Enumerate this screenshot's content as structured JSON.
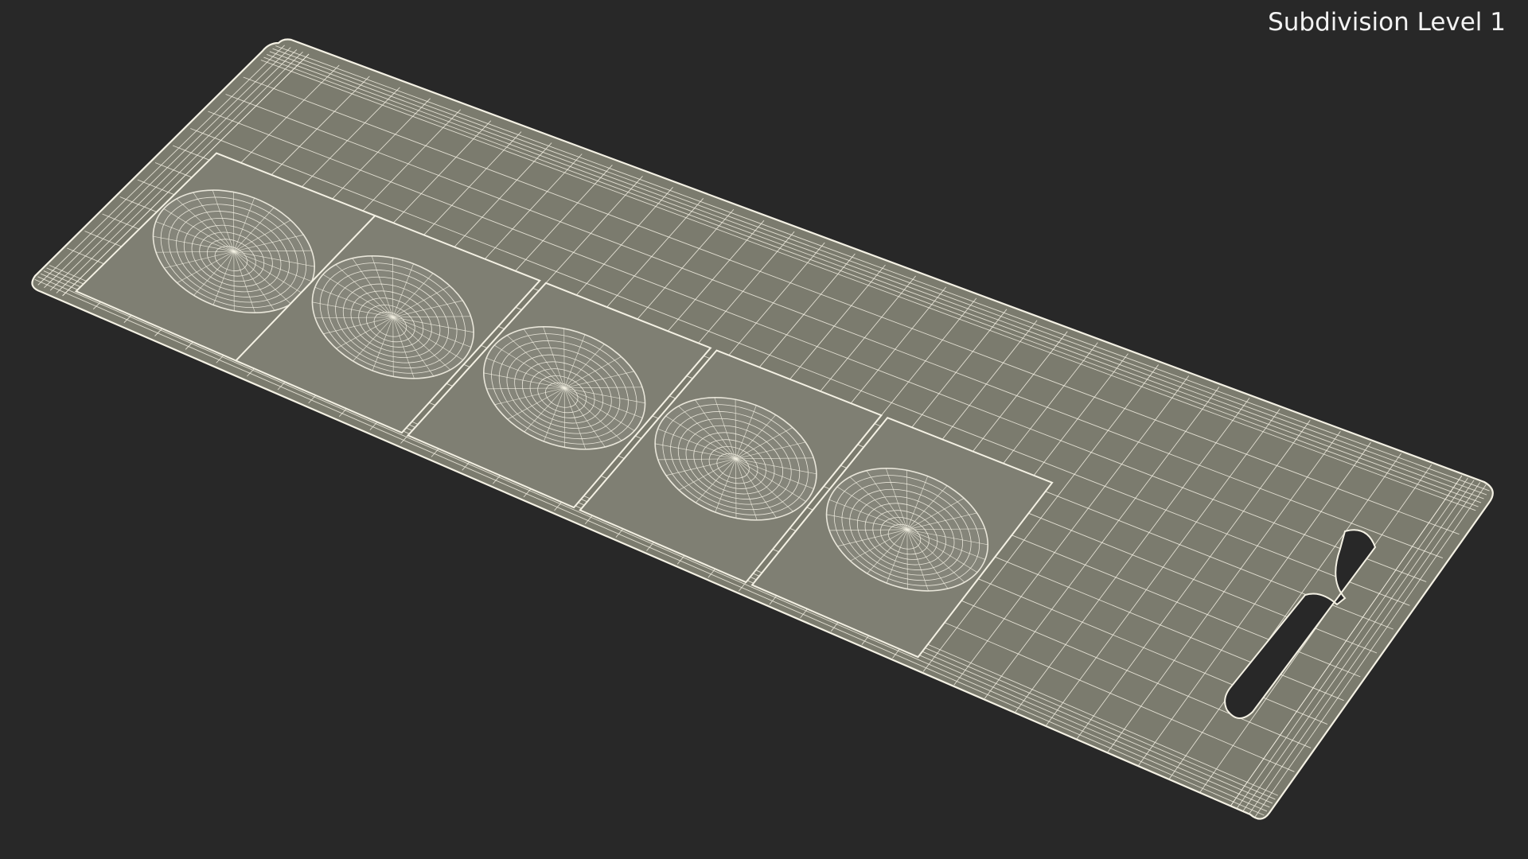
{
  "overlay": {
    "label": "Subdivision Level 1"
  },
  "render": {
    "background_color": "#282828",
    "surface_color": "#7b7b6e",
    "wire_color": "#f4f1e4",
    "blister_count": 5
  }
}
